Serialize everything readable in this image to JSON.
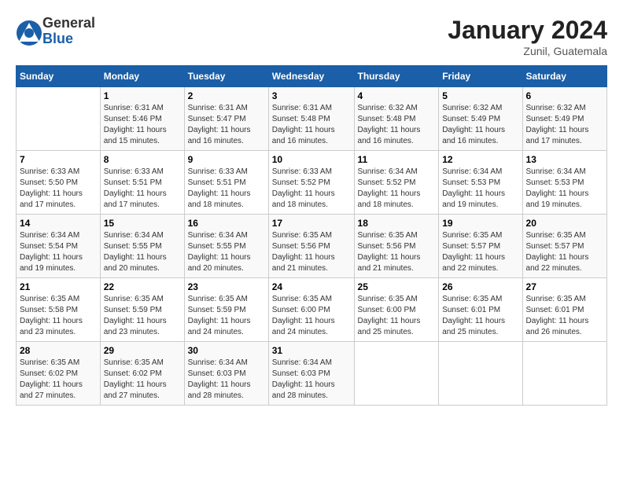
{
  "header": {
    "logo_general": "General",
    "logo_blue": "Blue",
    "month_title": "January 2024",
    "subtitle": "Zunil, Guatemala"
  },
  "days_of_week": [
    "Sunday",
    "Monday",
    "Tuesday",
    "Wednesday",
    "Thursday",
    "Friday",
    "Saturday"
  ],
  "weeks": [
    [
      {
        "day": "",
        "info": ""
      },
      {
        "day": "1",
        "info": "Sunrise: 6:31 AM\nSunset: 5:46 PM\nDaylight: 11 hours\nand 15 minutes."
      },
      {
        "day": "2",
        "info": "Sunrise: 6:31 AM\nSunset: 5:47 PM\nDaylight: 11 hours\nand 16 minutes."
      },
      {
        "day": "3",
        "info": "Sunrise: 6:31 AM\nSunset: 5:48 PM\nDaylight: 11 hours\nand 16 minutes."
      },
      {
        "day": "4",
        "info": "Sunrise: 6:32 AM\nSunset: 5:48 PM\nDaylight: 11 hours\nand 16 minutes."
      },
      {
        "day": "5",
        "info": "Sunrise: 6:32 AM\nSunset: 5:49 PM\nDaylight: 11 hours\nand 16 minutes."
      },
      {
        "day": "6",
        "info": "Sunrise: 6:32 AM\nSunset: 5:49 PM\nDaylight: 11 hours\nand 17 minutes."
      }
    ],
    [
      {
        "day": "7",
        "info": "Sunrise: 6:33 AM\nSunset: 5:50 PM\nDaylight: 11 hours\nand 17 minutes."
      },
      {
        "day": "8",
        "info": "Sunrise: 6:33 AM\nSunset: 5:51 PM\nDaylight: 11 hours\nand 17 minutes."
      },
      {
        "day": "9",
        "info": "Sunrise: 6:33 AM\nSunset: 5:51 PM\nDaylight: 11 hours\nand 18 minutes."
      },
      {
        "day": "10",
        "info": "Sunrise: 6:33 AM\nSunset: 5:52 PM\nDaylight: 11 hours\nand 18 minutes."
      },
      {
        "day": "11",
        "info": "Sunrise: 6:34 AM\nSunset: 5:52 PM\nDaylight: 11 hours\nand 18 minutes."
      },
      {
        "day": "12",
        "info": "Sunrise: 6:34 AM\nSunset: 5:53 PM\nDaylight: 11 hours\nand 19 minutes."
      },
      {
        "day": "13",
        "info": "Sunrise: 6:34 AM\nSunset: 5:53 PM\nDaylight: 11 hours\nand 19 minutes."
      }
    ],
    [
      {
        "day": "14",
        "info": "Sunrise: 6:34 AM\nSunset: 5:54 PM\nDaylight: 11 hours\nand 19 minutes."
      },
      {
        "day": "15",
        "info": "Sunrise: 6:34 AM\nSunset: 5:55 PM\nDaylight: 11 hours\nand 20 minutes."
      },
      {
        "day": "16",
        "info": "Sunrise: 6:34 AM\nSunset: 5:55 PM\nDaylight: 11 hours\nand 20 minutes."
      },
      {
        "day": "17",
        "info": "Sunrise: 6:35 AM\nSunset: 5:56 PM\nDaylight: 11 hours\nand 21 minutes."
      },
      {
        "day": "18",
        "info": "Sunrise: 6:35 AM\nSunset: 5:56 PM\nDaylight: 11 hours\nand 21 minutes."
      },
      {
        "day": "19",
        "info": "Sunrise: 6:35 AM\nSunset: 5:57 PM\nDaylight: 11 hours\nand 22 minutes."
      },
      {
        "day": "20",
        "info": "Sunrise: 6:35 AM\nSunset: 5:57 PM\nDaylight: 11 hours\nand 22 minutes."
      }
    ],
    [
      {
        "day": "21",
        "info": "Sunrise: 6:35 AM\nSunset: 5:58 PM\nDaylight: 11 hours\nand 23 minutes."
      },
      {
        "day": "22",
        "info": "Sunrise: 6:35 AM\nSunset: 5:59 PM\nDaylight: 11 hours\nand 23 minutes."
      },
      {
        "day": "23",
        "info": "Sunrise: 6:35 AM\nSunset: 5:59 PM\nDaylight: 11 hours\nand 24 minutes."
      },
      {
        "day": "24",
        "info": "Sunrise: 6:35 AM\nSunset: 6:00 PM\nDaylight: 11 hours\nand 24 minutes."
      },
      {
        "day": "25",
        "info": "Sunrise: 6:35 AM\nSunset: 6:00 PM\nDaylight: 11 hours\nand 25 minutes."
      },
      {
        "day": "26",
        "info": "Sunrise: 6:35 AM\nSunset: 6:01 PM\nDaylight: 11 hours\nand 25 minutes."
      },
      {
        "day": "27",
        "info": "Sunrise: 6:35 AM\nSunset: 6:01 PM\nDaylight: 11 hours\nand 26 minutes."
      }
    ],
    [
      {
        "day": "28",
        "info": "Sunrise: 6:35 AM\nSunset: 6:02 PM\nDaylight: 11 hours\nand 27 minutes."
      },
      {
        "day": "29",
        "info": "Sunrise: 6:35 AM\nSunset: 6:02 PM\nDaylight: 11 hours\nand 27 minutes."
      },
      {
        "day": "30",
        "info": "Sunrise: 6:34 AM\nSunset: 6:03 PM\nDaylight: 11 hours\nand 28 minutes."
      },
      {
        "day": "31",
        "info": "Sunrise: 6:34 AM\nSunset: 6:03 PM\nDaylight: 11 hours\nand 28 minutes."
      },
      {
        "day": "",
        "info": ""
      },
      {
        "day": "",
        "info": ""
      },
      {
        "day": "",
        "info": ""
      }
    ]
  ]
}
